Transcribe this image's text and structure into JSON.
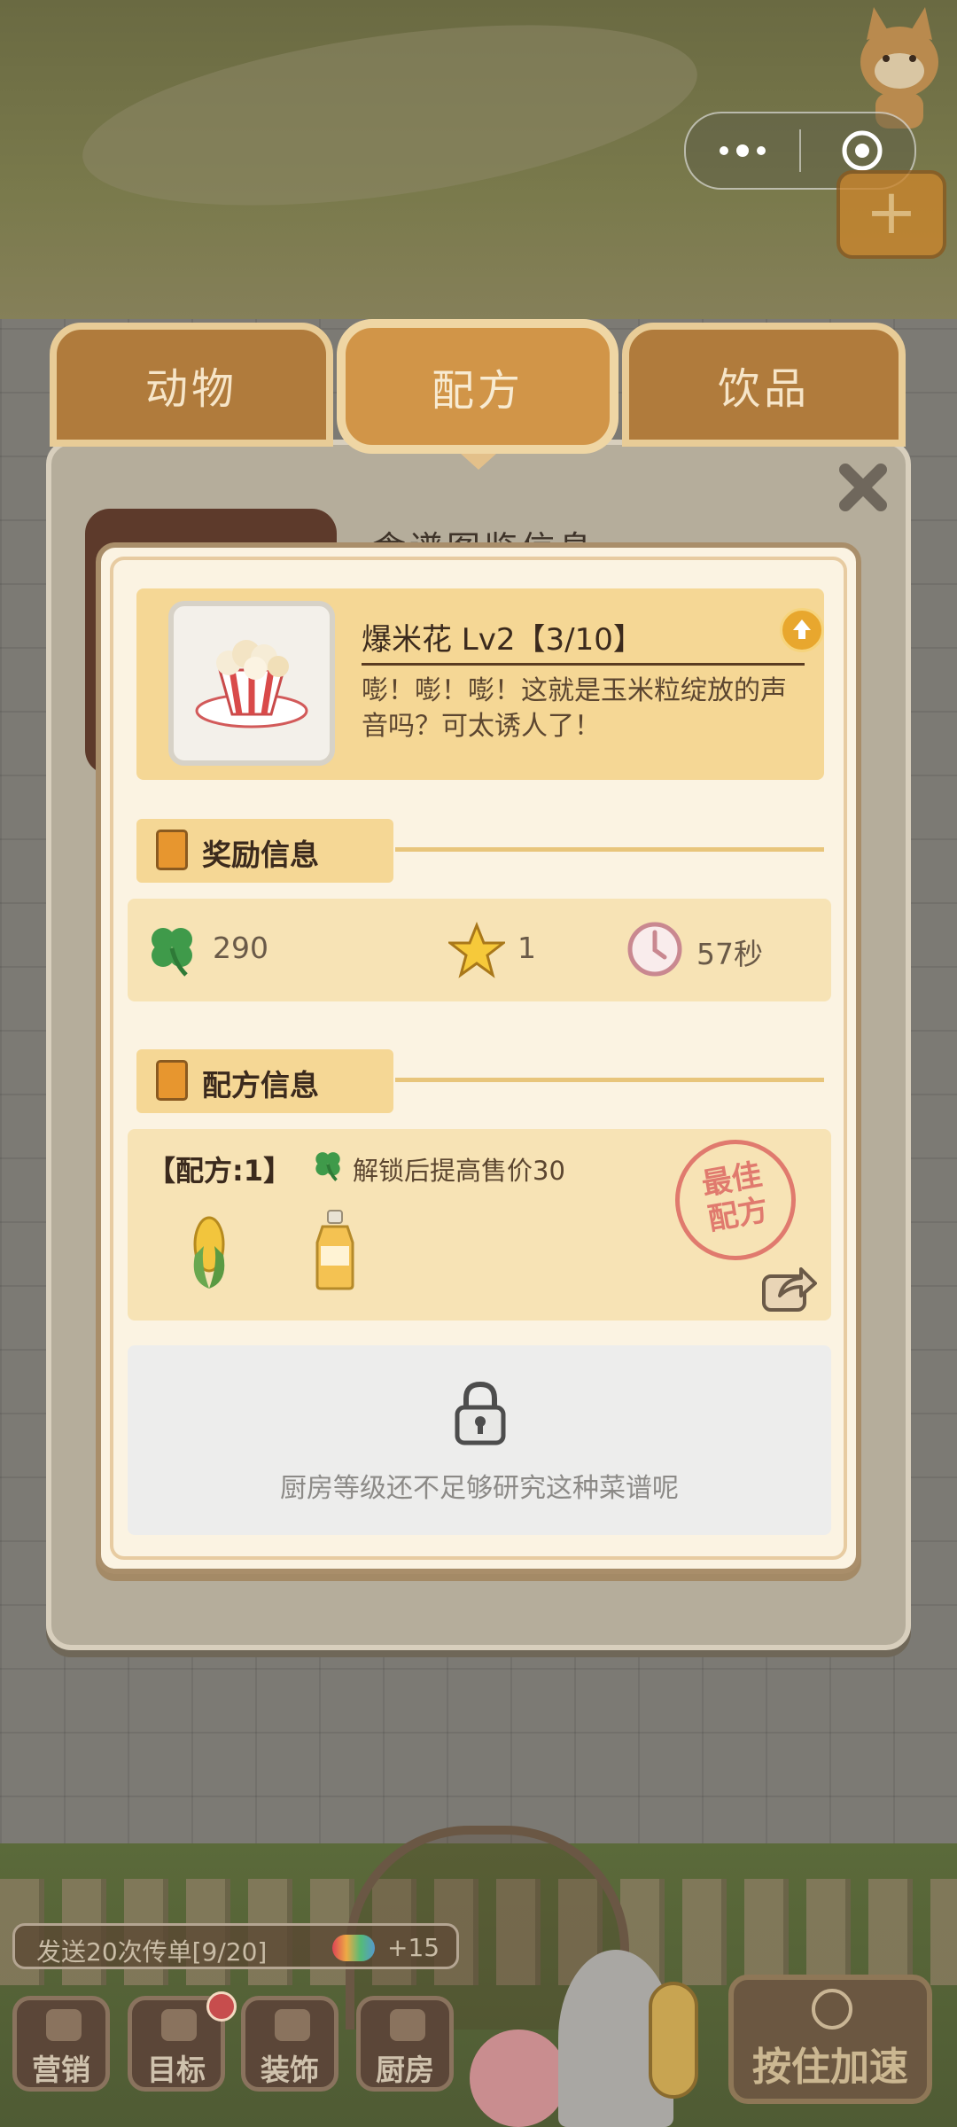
{
  "tabs": [
    {
      "label": "动物"
    },
    {
      "label": "配方"
    },
    {
      "label": "饮品"
    }
  ],
  "panel": {
    "title_partial": "食谱图鉴信息"
  },
  "item": {
    "name": "爆米花 Lv2【3/10】",
    "description": "嘭！嘭！嘭！这就是玉米粒绽放的声音吗？可太诱人了！"
  },
  "reward": {
    "section_title": "奖励信息",
    "clover_value": "290",
    "star_value": "1",
    "time_value": "57秒"
  },
  "recipe": {
    "section_title": "配方信息",
    "header": "【配方:1】",
    "hint": "解锁后提高售价30",
    "best_stamp_line1": "最佳",
    "best_stamp_line2": "配方",
    "ingredients": [
      {
        "icon": "corn-icon"
      },
      {
        "icon": "oil-bottle-icon"
      }
    ]
  },
  "locked": {
    "text": "厨房等级还不足够研究这种菜谱呢"
  },
  "task": {
    "text": "发送20次传单[9/20]",
    "reward": "+15"
  },
  "bottom_menu": [
    {
      "label": "营销"
    },
    {
      "label": "目标"
    },
    {
      "label": "装饰"
    },
    {
      "label": "厨房"
    }
  ],
  "speed_button": {
    "label": "按住加速"
  },
  "colors": {
    "tab_active": "#d19548",
    "tab_inactive": "#b07b3c",
    "modal_bg": "#fbf3e2",
    "card_yellow": "#f5d795",
    "stamp_red": "#e07a6e"
  }
}
